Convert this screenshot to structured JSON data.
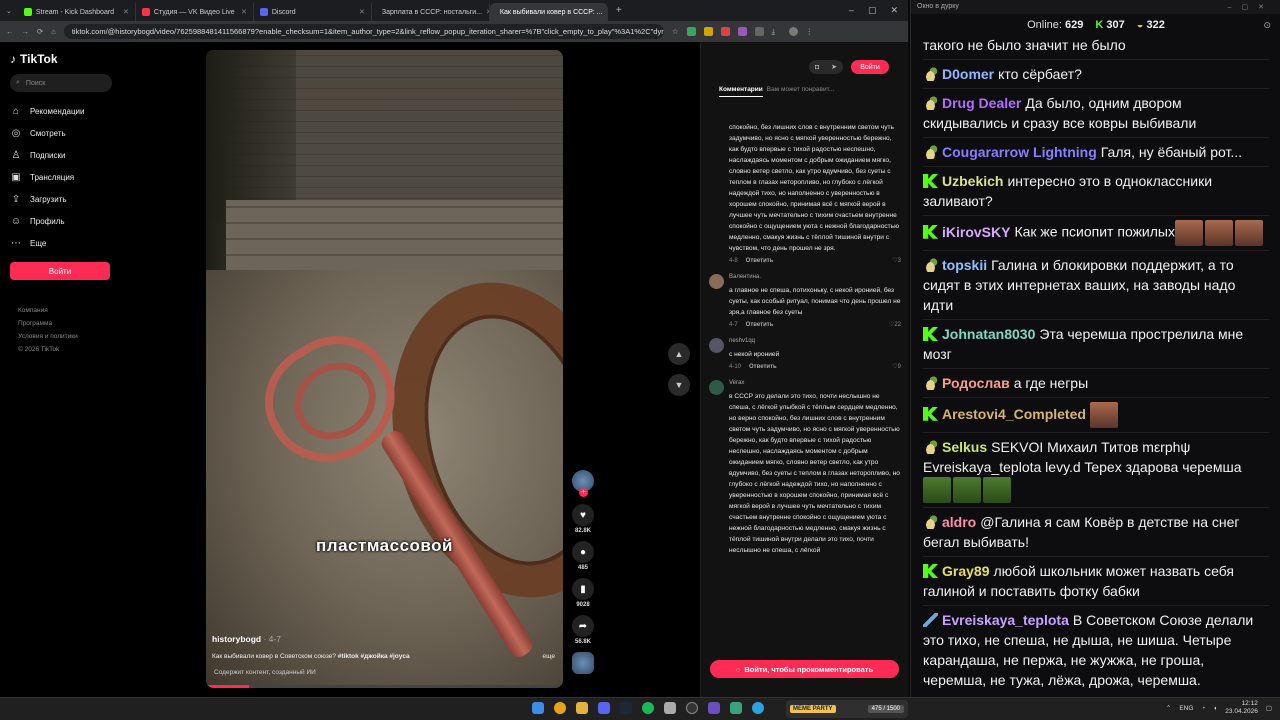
{
  "browser": {
    "tabs": [
      {
        "label": "Stream - Kick Dashboard",
        "color": "#53fc18"
      },
      {
        "label": "Студия — VK Видео Live",
        "color": "#ff3347"
      },
      {
        "label": "Discord",
        "color": "#5865f2"
      },
      {
        "label": "Зарплата в СССР: ностальги...",
        "color": "#ffffff"
      },
      {
        "label": "Как выбивали ковер в СССР: ...",
        "color": "#ffffff",
        "active": true
      }
    ],
    "url": "tiktok.com/@historybogd/video/7625988481411566879?enable_checksum=1&item_author_type=2&link_reflow_popup_iteration_sharer=%7B\"click_empty_to_play\"%3A1%2C\"dynami..."
  },
  "tiktok": {
    "logo": "TikTok",
    "search_placeholder": "Поиск",
    "nav": [
      {
        "icon": "⌂",
        "label": "Рекомендации",
        "name": "home-icon"
      },
      {
        "icon": "◎",
        "label": "Смотреть",
        "name": "compass-icon"
      },
      {
        "icon": "♙",
        "label": "Подписки",
        "name": "person-icon"
      },
      {
        "icon": "▣",
        "label": "Трансляция",
        "name": "live-icon"
      },
      {
        "icon": "⇪",
        "label": "Загрузить",
        "name": "upload-icon"
      },
      {
        "icon": "☺",
        "label": "Профиль",
        "name": "profile-icon"
      },
      {
        "icon": "⋯",
        "label": "Еще",
        "name": "more-icon"
      }
    ],
    "login_button": "Войти",
    "footer": [
      "Компания",
      "Программа",
      "Условия и политики",
      "© 2026 TikTok"
    ]
  },
  "video": {
    "overlay_text": "пластмассовой",
    "author": "historybogd",
    "ago": "· 4-7",
    "caption": "Как выбивали ковер в Советском союзе?",
    "tags": "#tiktok #джойка #joyca",
    "more": "еще",
    "aigc": "Содержит контент, созданный ИИ",
    "progress": 0.12
  },
  "actions": {
    "likes": "82.8K",
    "comments": "485",
    "saves": "9028",
    "shares": "56.8K"
  },
  "comments_panel": {
    "login_button": "Войти",
    "tab_comments": "Комментарии",
    "tab_related": "Вам может понравит...",
    "items": [
      {
        "name": "",
        "text": "спокойно, без лишних слов с внутренним светом чуть задумчиво, но ясно с мягкой уверенностью бережно, как будто впервые с тихой радостью неспешно, наслаждаясь моментом с добрым ожиданием мягко, словно ветер светло, как утро вдумчиво, без суеты с теплом в глазах неторопливо, но глубоко с лёгкой надеждой тихо, но наполненно с уверенностью в хорошем спокойно, принимая всё с мягкой верой в лучшее чуть мечтательно с тихим счастьем внутренне спокойно с ощущением уюта с нежной благодарностью медленно, смакуя жизнь с тёплой тишиной внутри с чувством, что день прошел не зря.",
        "date": "4-8",
        "reply": "Ответить",
        "likes": "3"
      },
      {
        "name": "Валентина.",
        "text": "а главное не спеша, потихоньку, с некой иронией, без суеты, как особый ритуал, понимая что день прошел не зря,а главное без суеты",
        "date": "4-7",
        "reply": "Ответить",
        "likes": "22"
      },
      {
        "name": "neshv1qq",
        "text": "с некой иронией",
        "date": "4-10",
        "reply": "Ответить",
        "likes": "9"
      },
      {
        "name": "Verax",
        "text": "в СССР это делали это тихо, почти неслышно не спеша, с лёгкой улыбкой с тёплым сердцем медленно, но верно спокойно, без лишних слов с внутренним светом чуть задумчиво, но ясно с мягкой уверенностью бережно, как будто впервые с тихой радостью неспешно, наслаждаясь моментом с добрым ожиданием мягко, словно ветер светло, как утро вдумчиво, без суеты с теплом в глазах неторопливо, но глубоко с лёгкой надеждой тихо, но наполненно с уверенностью в хорошем спокойно, принимая всё с мягкой верой в лучшее чуть мечтательно с тихим счастьем внутренне спокойно с ощущением уюта с нежной благодарностью медленно, смакуя жизнь с тёплой тишиной внутри делали это тихо, почти неслышно не спеша, с лёгкой",
        "date": "",
        "reply": "",
        "likes": ""
      }
    ],
    "cta": "Войти, чтобы прокомментировать"
  },
  "chat": {
    "window_title": "Окно в дурку",
    "online_label": "Online:",
    "online": "629",
    "kick_count": "307",
    "other_count": "322",
    "messages": [
      {
        "badge": "",
        "user": "",
        "color": "#ffffff",
        "text": "такого не было значит не было"
      },
      {
        "badge": "bowl",
        "user": "D0omer",
        "color": "#8fb8ff",
        "text": "кто сёрбает?"
      },
      {
        "badge": "bowl",
        "user": "Drug Dealer",
        "color": "#b26cff",
        "text": "Да было, одним двором скидывались и сразу все ковры выбивали"
      },
      {
        "badge": "bowl",
        "user": "Cougararrow Lightning",
        "color": "#8a7dff",
        "text": "Галя, ну ёбаный рот..."
      },
      {
        "badge": "kick",
        "user": "Uzbekich",
        "color": "#d8e28a",
        "text": "интересно это в одноклассники заливают?"
      },
      {
        "badge": "kick",
        "user": "iKirovSKY",
        "color": "#d9a7ff",
        "text": "Как же псиопит пожилых",
        "emotes": 3
      },
      {
        "badge": "bowl",
        "user": "topskii",
        "color": "#8fc0ff",
        "text": "Галина и блокировки поддержит, а то сидят в этих интернетах ваших, на заводы надо идти"
      },
      {
        "badge": "kick",
        "user": "Johnatan8030",
        "color": "#7fd9c0",
        "text": "Эта черемша прострелила мне мозг"
      },
      {
        "badge": "bowl",
        "user": "Родослав",
        "color": "#ff9a8a",
        "text": "а где негры"
      },
      {
        "badge": "kick",
        "user": "Arestovi4_Completed",
        "color": "#d9b36b",
        "text": "",
        "emotes": 1
      },
      {
        "badge": "bowl",
        "user": "Selkus",
        "color": "#c8e86a",
        "text": "SEKVOI Михаил Титов mεrphψ Evreiskaya_teplota levy.d Tepex здарова черемша",
        "green_emotes": 3
      },
      {
        "badge": "bowl",
        "user": "aldro",
        "color": "#ff8fa8",
        "text": "@Галина я сам Ковёр в детстве на снег бегал выбивать!"
      },
      {
        "badge": "kick",
        "user": "Gray89",
        "color": "#e8e05a",
        "text": "любой школьник может назвать себя галиной и поставить фотку бабки"
      },
      {
        "badge": "sword",
        "user": "Evreiskaya_teplota",
        "color": "#c9a2ff",
        "text": "В Советском Союзе делали это тихо, не спеша, не дыша, не шиша. Четыре карандаша, не пержа, не жужжа, не гроша, черемша, не тужа, лёжа, дрожа, черемша."
      }
    ]
  },
  "taskbar": {
    "widget_label": "MEME PARTY",
    "widget_hp": "475 / 1500",
    "lang": "ENG",
    "time": "12:12",
    "date": "23.04.2026"
  }
}
